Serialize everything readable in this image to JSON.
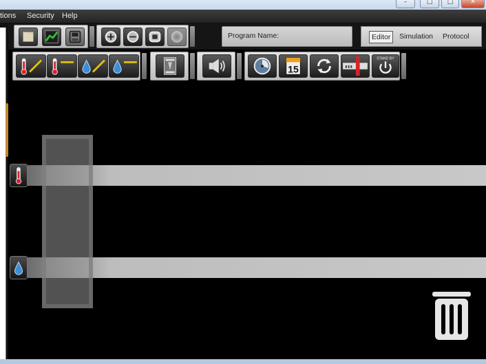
{
  "window": {
    "controls": {
      "minimize": "–",
      "maximize": "□",
      "close": "✕"
    }
  },
  "menu": {
    "items": [
      {
        "label": "tions"
      },
      {
        "label": "Security"
      },
      {
        "label": "Help"
      }
    ]
  },
  "toolbar_top": {
    "file_buttons": [
      "open-icon",
      "chart-icon",
      "save-icon"
    ],
    "zoom_buttons": [
      "zoom-in-icon",
      "zoom-out-icon",
      "zoom-fit-icon",
      "zoom-reset-icon"
    ],
    "program_name_label": "Program Name:",
    "modes": [
      "Editor",
      "Simulation",
      "Protocol"
    ],
    "active_mode": "Editor"
  },
  "toolbar_bottom": {
    "ramp_buttons": [
      "temperature-ramp-icon",
      "temperature-hold-icon",
      "humidity-ramp-icon",
      "humidity-hold-icon"
    ],
    "other_buttons": [
      "specimen-icon",
      "speaker-icon",
      "timer-icon",
      "calendar-icon",
      "loop-icon",
      "slider-icon"
    ],
    "calendar_day": "15",
    "standby_label": "STAND BY"
  },
  "tracks": [
    {
      "icon": "thermometer-icon"
    },
    {
      "icon": "water-drop-icon"
    }
  ],
  "colors": {
    "accent_red": "#d5232a",
    "accent_blue": "#3a8fd6",
    "accent_yellow": "#e4c200",
    "background": "#000000"
  }
}
